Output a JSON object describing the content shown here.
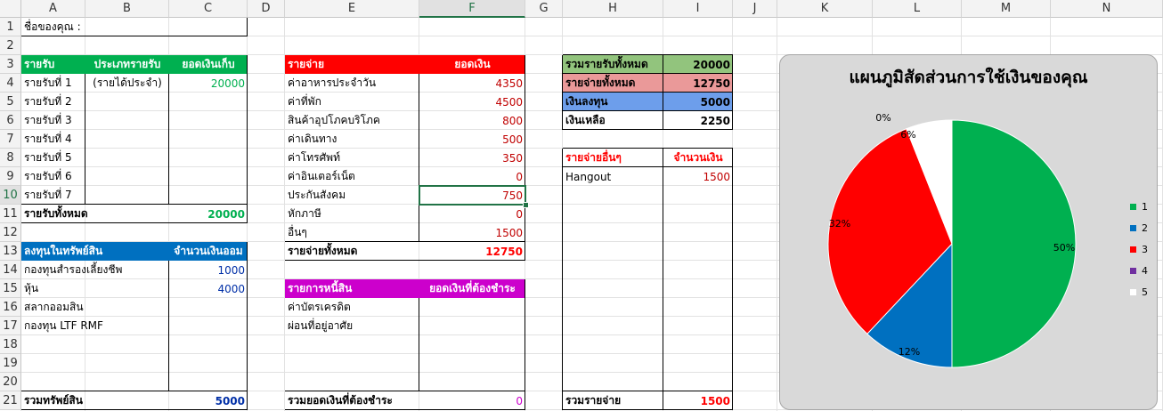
{
  "columns": [
    "A",
    "B",
    "C",
    "D",
    "E",
    "F",
    "G",
    "H",
    "I",
    "J",
    "K",
    "L",
    "M",
    "N"
  ],
  "rows": [
    "1",
    "2",
    "3",
    "4",
    "5",
    "6",
    "7",
    "8",
    "9",
    "10",
    "11",
    "12",
    "13",
    "14",
    "15",
    "16",
    "17",
    "18",
    "19",
    "20",
    "21"
  ],
  "name_label": "ชื่อของคุณ :",
  "income": {
    "header": [
      "รายรับ",
      "ประเภทรายรับ",
      "ยอดเงินเก็บ"
    ],
    "items": [
      {
        "name": "รายรับที่ 1",
        "type": "(รายได้ประจำ)",
        "amount": "20000"
      },
      {
        "name": "รายรับที่ 2",
        "type": "",
        "amount": ""
      },
      {
        "name": "รายรับที่ 3",
        "type": "",
        "amount": ""
      },
      {
        "name": "รายรับที่ 4",
        "type": "",
        "amount": ""
      },
      {
        "name": "รายรับที่ 5",
        "type": "",
        "amount": ""
      },
      {
        "name": "รายรับที่ 6",
        "type": "",
        "amount": ""
      },
      {
        "name": "รายรับที่ 7",
        "type": "",
        "amount": ""
      }
    ],
    "total_label": "รายรับทั้งหมด",
    "total": "20000"
  },
  "investment": {
    "header": [
      "ลงทุนในทรัพย์สิน",
      "จำนวนเงินออม"
    ],
    "items": [
      {
        "name": "กองทุนสำรองเลี้ยงชีพ",
        "amount": "1000"
      },
      {
        "name": "หุ้น",
        "amount": "4000"
      },
      {
        "name": "สลากออมสิน",
        "amount": ""
      },
      {
        "name": "กองทุน LTF RMF",
        "amount": ""
      }
    ],
    "total_label": "รวมทรัพย์สิน",
    "total": "5000"
  },
  "expense": {
    "header": [
      "รายจ่าย",
      "ยอดเงิน"
    ],
    "items": [
      {
        "name": "ค่าอาหารประจำวัน",
        "amount": "4350"
      },
      {
        "name": "ค่าที่พัก",
        "amount": "4500"
      },
      {
        "name": "สินค้าอุปโภคบริโภค",
        "amount": "800"
      },
      {
        "name": "ค่าเดินทาง",
        "amount": "500"
      },
      {
        "name": "ค่าโทรศัพท์",
        "amount": "350"
      },
      {
        "name": "ค่าอินเตอร์เน็ต",
        "amount": "0"
      },
      {
        "name": "ประกันสังคม",
        "amount": "750"
      },
      {
        "name": "หักภาษี",
        "amount": "0"
      },
      {
        "name": "อื่นๆ",
        "amount": "1500"
      }
    ],
    "total_label": "รายจ่ายทั้งหมด",
    "total": "12750"
  },
  "debt": {
    "header": [
      "รายการหนี้สิน",
      "ยอดเงินที่ต้องชำระ"
    ],
    "items": [
      {
        "name": "ค่าบัตรเครดิต",
        "amount": ""
      },
      {
        "name": "ผ่อนที่อยู่อาศัย",
        "amount": ""
      }
    ],
    "total_label": "รวมยอดเงินที่ต้องชำระ",
    "total": "0"
  },
  "summary": [
    {
      "label": "รวมรายรับทั้งหมด",
      "value": "20000",
      "color": "#92c47d"
    },
    {
      "label": "รายจ่ายทั้งหมด",
      "value": "12750",
      "color": "#ea9999"
    },
    {
      "label": "เงินลงทุน",
      "value": "5000",
      "color": "#6d9eeb"
    },
    {
      "label": "เงินเหลือ",
      "value": "2250",
      "color": "#ffffff"
    }
  ],
  "other_expense": {
    "header": [
      "รายจ่ายอื่นๆ",
      "จำนวนเงิน"
    ],
    "items": [
      {
        "name": "Hangout",
        "amount": "1500"
      }
    ],
    "total_label": "รวมรายจ่าย",
    "total": "1500"
  },
  "colors": {
    "green_header": "#00b050",
    "red_header": "#ff0000",
    "blue_header": "#0070c0",
    "magenta_header": "#cc00cc",
    "income_value": "#00b050",
    "expense_value": "#c00000",
    "invest_value": "#002fa7",
    "debt_value": "#cc00cc"
  },
  "chart_data": {
    "type": "pie",
    "title": "แผนภูมิสัดส่วนการใช้เงินของคุณ",
    "categories": [
      "1",
      "2",
      "3",
      "4",
      "5"
    ],
    "values": [
      50,
      12,
      32,
      0,
      6
    ],
    "labels": [
      "50%",
      "12%",
      "32%",
      "0%",
      "6%"
    ],
    "colors": [
      "#00b050",
      "#0070c0",
      "#ff0000",
      "#7030a0",
      "#ffffff"
    ],
    "legend_position": "right"
  }
}
